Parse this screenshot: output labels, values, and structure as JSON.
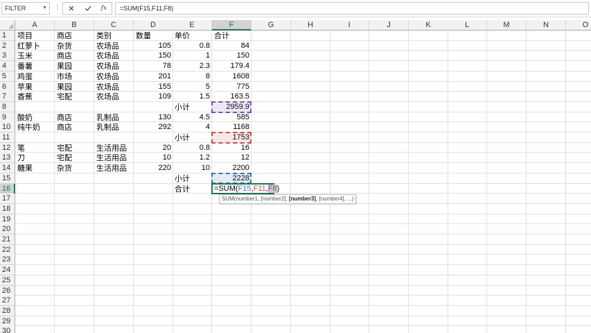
{
  "formula_bar": {
    "name_box": "FILTER",
    "cancel_icon": "x-icon",
    "enter_icon": "check-icon",
    "fx_label": "fx",
    "formula": "=SUM(F15,F11,F8)"
  },
  "columns": [
    "A",
    "B",
    "C",
    "D",
    "E",
    "F",
    "G",
    "H",
    "I",
    "J",
    "K",
    "L",
    "M",
    "N",
    "O"
  ],
  "active_column": "F",
  "active_row": 16,
  "rows": [
    {
      "n": 1,
      "A": "项目",
      "B": "商店",
      "C": "类别",
      "D": "数量",
      "E": "单价",
      "F": "合计"
    },
    {
      "n": 2,
      "A": "红萝卜",
      "B": "杂货",
      "C": "农场品",
      "D": "105",
      "E": "0.8",
      "F": "84"
    },
    {
      "n": 3,
      "A": "玉米",
      "B": "商店",
      "C": "农场品",
      "D": "150",
      "E": "1",
      "F": "150"
    },
    {
      "n": 4,
      "A": "番薯",
      "B": "果园",
      "C": "农场品",
      "D": "78",
      "E": "2.3",
      "F": "179.4"
    },
    {
      "n": 5,
      "A": "鸡蛋",
      "B": "市场",
      "C": "农场品",
      "D": "201",
      "E": "8",
      "F": "1608"
    },
    {
      "n": 6,
      "A": "苹果",
      "B": "果园",
      "C": "农场品",
      "D": "155",
      "E": "5",
      "F": "775"
    },
    {
      "n": 7,
      "A": "香蕉",
      "B": "宅配",
      "C": "农场品",
      "D": "109",
      "E": "1.5",
      "F": "163.5"
    },
    {
      "n": 8,
      "E": "小计",
      "F": "2959.9"
    },
    {
      "n": 9,
      "A": "酸奶",
      "B": "商店",
      "C": "乳制品",
      "D": "130",
      "E": "4.5",
      "F": "585"
    },
    {
      "n": 10,
      "A": "纯牛奶",
      "B": "商店",
      "C": "乳制品",
      "D": "292",
      "E": "4",
      "F": "1168"
    },
    {
      "n": 11,
      "E": "小计",
      "F": "1753"
    },
    {
      "n": 12,
      "A": "笔",
      "B": "宅配",
      "C": "生活用品",
      "D": "20",
      "E": "0.8",
      "F": "16"
    },
    {
      "n": 13,
      "A": "刀",
      "B": "宅配",
      "C": "生活用品",
      "D": "10",
      "E": "1.2",
      "F": "12"
    },
    {
      "n": 14,
      "A": "糖果",
      "B": "杂货",
      "C": "生活用品",
      "D": "220",
      "E": "10",
      "F": "2200"
    },
    {
      "n": 15,
      "E": "小计",
      "F": "2228"
    },
    {
      "n": 16,
      "E": "合计"
    },
    {
      "n": 17
    },
    {
      "n": 18
    },
    {
      "n": 19
    },
    {
      "n": 20
    },
    {
      "n": 21
    },
    {
      "n": 22
    },
    {
      "n": 23
    },
    {
      "n": 24
    },
    {
      "n": 25
    },
    {
      "n": 26
    },
    {
      "n": 27
    },
    {
      "n": 28
    },
    {
      "n": 29
    },
    {
      "n": 30
    }
  ],
  "edit_cell": {
    "prefix": "=SUM(",
    "refs": [
      {
        "text": "F15",
        "color": "#3d6fb5"
      },
      {
        "text": ",",
        "color": "#000000"
      },
      {
        "text": "F11",
        "color": "#c0504d"
      },
      {
        "text": ",",
        "color": "#000000"
      },
      {
        "text": "F8",
        "color": "#7e4fa6"
      }
    ],
    "suffix": ")"
  },
  "ref_highlights": [
    {
      "cell": "F8",
      "color": "#7e4fa6"
    },
    {
      "cell": "F11",
      "color": "#c0504d"
    },
    {
      "cell": "F15",
      "color": "#3d6fb5"
    }
  ],
  "tooltip": {
    "fn": "SUM(",
    "arg1": "number1, [number2], ",
    "current": "[number3]",
    "rest": ", [number4], ...)"
  }
}
